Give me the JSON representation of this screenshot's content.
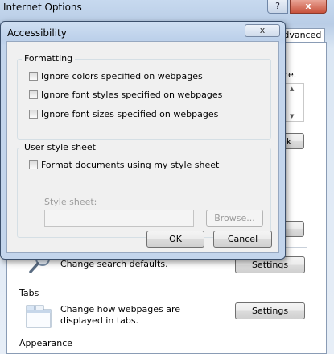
{
  "background_window": {
    "title": "Internet Options",
    "help_button": "?",
    "close_button": "x",
    "active_tab": "Advanced",
    "fragment_ine": "ine.",
    "fragment_k": "k",
    "search": {
      "description": "Change search defaults.",
      "settings_label": "Settings",
      "icon": "magnifier-icon"
    },
    "tabs_section": {
      "label": "Tabs",
      "description": "Change how webpages are displayed in tabs.",
      "settings_label": "Settings",
      "icon": "tabbed-window-icon"
    },
    "appearance_label": "Appearance"
  },
  "dialog": {
    "title": "Accessibility",
    "close_symbol": "x",
    "formatting": {
      "label": "Formatting",
      "options": [
        {
          "label": "Ignore colors specified on webpages",
          "checked": false
        },
        {
          "label": "Ignore font styles specified on webpages",
          "checked": false
        },
        {
          "label": "Ignore font sizes specified on webpages",
          "checked": false
        }
      ]
    },
    "user_style_sheet": {
      "label": "User style sheet",
      "checkbox_label": "Format documents using my style sheet",
      "checked": false,
      "field_label": "Style sheet:",
      "field_value": "",
      "browse_label": "Browse..."
    },
    "ok_label": "OK",
    "cancel_label": "Cancel"
  },
  "colors": {
    "dialog_frame": "#c3d5ec",
    "dialog_body": "#f0f0f0",
    "close_red": "#c8523c"
  }
}
